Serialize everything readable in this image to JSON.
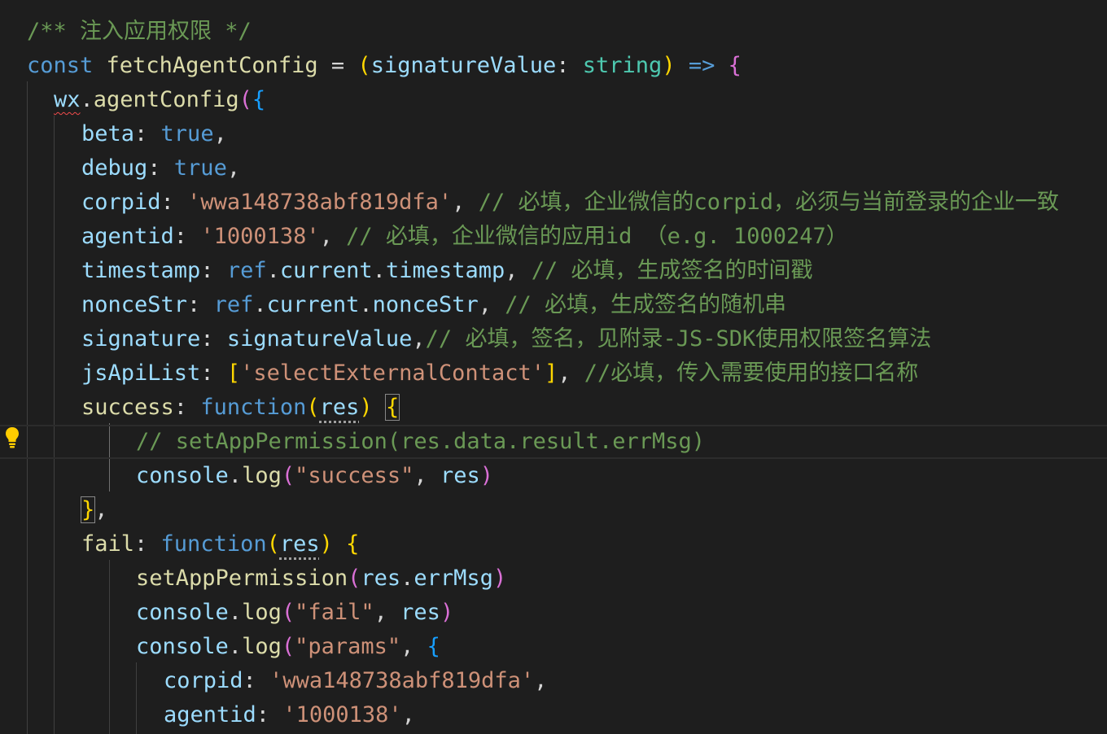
{
  "editor": {
    "lines": [
      {
        "tokens": [
          {
            "t": "/** 注入应用权限 */",
            "c": "cm"
          }
        ]
      },
      {
        "tokens": [
          {
            "t": "const ",
            "c": "kw"
          },
          {
            "t": "fetchAgentConfig",
            "c": "fn"
          },
          {
            "t": " = ",
            "c": "pu"
          },
          {
            "t": "(",
            "c": "b1"
          },
          {
            "t": "signatureValue",
            "c": "vr"
          },
          {
            "t": ": ",
            "c": "pu"
          },
          {
            "t": "string",
            "c": "ty"
          },
          {
            "t": ")",
            "c": "b1"
          },
          {
            "t": " => ",
            "c": "kw"
          },
          {
            "t": "{",
            "c": "b2"
          }
        ]
      },
      {
        "tokens": [
          {
            "t": "wx",
            "c": "vr",
            "sq": true
          },
          {
            "t": ".",
            "c": "pu"
          },
          {
            "t": "agentConfig",
            "c": "fn"
          },
          {
            "t": "(",
            "c": "b2"
          },
          {
            "t": "{",
            "c": "b3"
          }
        ]
      },
      {
        "tokens": [
          {
            "t": "beta",
            "c": "vr"
          },
          {
            "t": ": ",
            "c": "pu"
          },
          {
            "t": "true",
            "c": "kw"
          },
          {
            "t": ",",
            "c": "pu"
          }
        ]
      },
      {
        "tokens": [
          {
            "t": "debug",
            "c": "vr"
          },
          {
            "t": ": ",
            "c": "pu"
          },
          {
            "t": "true",
            "c": "kw"
          },
          {
            "t": ",",
            "c": "pu"
          }
        ]
      },
      {
        "tokens": [
          {
            "t": "corpid",
            "c": "vr"
          },
          {
            "t": ": ",
            "c": "pu"
          },
          {
            "t": "'wwa148738abf819dfa'",
            "c": "st"
          },
          {
            "t": ", ",
            "c": "pu"
          },
          {
            "t": "// 必填，企业微信的corpid，必须与当前登录的企业一致",
            "c": "cm"
          }
        ]
      },
      {
        "tokens": [
          {
            "t": "agentid",
            "c": "vr"
          },
          {
            "t": ": ",
            "c": "pu"
          },
          {
            "t": "'1000138'",
            "c": "st"
          },
          {
            "t": ", ",
            "c": "pu"
          },
          {
            "t": "// 必填，企业微信的应用id （e.g. 1000247）",
            "c": "cm"
          }
        ]
      },
      {
        "tokens": [
          {
            "t": "timestamp",
            "c": "vr"
          },
          {
            "t": ": ",
            "c": "pu"
          },
          {
            "t": "ref",
            "c": "kw"
          },
          {
            "t": ".",
            "c": "pu"
          },
          {
            "t": "current",
            "c": "vr"
          },
          {
            "t": ".",
            "c": "pu"
          },
          {
            "t": "timestamp",
            "c": "vr"
          },
          {
            "t": ", ",
            "c": "pu"
          },
          {
            "t": "// 必填，生成签名的时间戳",
            "c": "cm"
          }
        ]
      },
      {
        "tokens": [
          {
            "t": "nonceStr",
            "c": "vr"
          },
          {
            "t": ": ",
            "c": "pu"
          },
          {
            "t": "ref",
            "c": "kw"
          },
          {
            "t": ".",
            "c": "pu"
          },
          {
            "t": "current",
            "c": "vr"
          },
          {
            "t": ".",
            "c": "pu"
          },
          {
            "t": "nonceStr",
            "c": "vr"
          },
          {
            "t": ", ",
            "c": "pu"
          },
          {
            "t": "// 必填，生成签名的随机串",
            "c": "cm"
          }
        ]
      },
      {
        "tokens": [
          {
            "t": "signature",
            "c": "vr"
          },
          {
            "t": ": ",
            "c": "pu"
          },
          {
            "t": "signatureValue",
            "c": "vr"
          },
          {
            "t": ",",
            "c": "pu"
          },
          {
            "t": "// 必填，签名，见附录-JS-SDK使用权限签名算法",
            "c": "cm"
          }
        ]
      },
      {
        "tokens": [
          {
            "t": "jsApiList",
            "c": "vr"
          },
          {
            "t": ": ",
            "c": "pu"
          },
          {
            "t": "[",
            "c": "b1"
          },
          {
            "t": "'selectExternalContact'",
            "c": "st"
          },
          {
            "t": "]",
            "c": "b1"
          },
          {
            "t": ", ",
            "c": "pu"
          },
          {
            "t": "//必填，传入需要使用的接口名称",
            "c": "cm"
          }
        ]
      },
      {
        "tokens": [
          {
            "t": "success",
            "c": "fn"
          },
          {
            "t": ": ",
            "c": "pu"
          },
          {
            "t": "function",
            "c": "kw"
          },
          {
            "t": "(",
            "c": "b1"
          },
          {
            "t": "res",
            "c": "vr",
            "dots": true
          },
          {
            "t": ")",
            "c": "b1"
          },
          {
            "t": " ",
            "c": "pu"
          },
          {
            "t": "{",
            "c": "b1",
            "box": true
          }
        ]
      },
      {
        "tokens": [
          {
            "t": "// setAppPermission(res.data.result.errMsg)",
            "c": "cm"
          }
        ]
      },
      {
        "tokens": [
          {
            "t": "console",
            "c": "vr"
          },
          {
            "t": ".",
            "c": "pu"
          },
          {
            "t": "log",
            "c": "fn"
          },
          {
            "t": "(",
            "c": "b2"
          },
          {
            "t": "\"success\"",
            "c": "st"
          },
          {
            "t": ", ",
            "c": "pu"
          },
          {
            "t": "res",
            "c": "vr"
          },
          {
            "t": ")",
            "c": "b2"
          }
        ]
      },
      {
        "tokens": [
          {
            "t": "}",
            "c": "b1",
            "box": true
          },
          {
            "t": ",",
            "c": "pu"
          }
        ]
      },
      {
        "tokens": [
          {
            "t": "fail",
            "c": "fn"
          },
          {
            "t": ": ",
            "c": "pu"
          },
          {
            "t": "function",
            "c": "kw"
          },
          {
            "t": "(",
            "c": "b1"
          },
          {
            "t": "res",
            "c": "vr",
            "dots": true
          },
          {
            "t": ")",
            "c": "b1"
          },
          {
            "t": " ",
            "c": "pu"
          },
          {
            "t": "{",
            "c": "b1"
          }
        ]
      },
      {
        "tokens": [
          {
            "t": "setAppPermission",
            "c": "fn"
          },
          {
            "t": "(",
            "c": "b2"
          },
          {
            "t": "res",
            "c": "vr"
          },
          {
            "t": ".",
            "c": "pu"
          },
          {
            "t": "errMsg",
            "c": "vr"
          },
          {
            "t": ")",
            "c": "b2"
          }
        ]
      },
      {
        "tokens": [
          {
            "t": "console",
            "c": "vr"
          },
          {
            "t": ".",
            "c": "pu"
          },
          {
            "t": "log",
            "c": "fn"
          },
          {
            "t": "(",
            "c": "b2"
          },
          {
            "t": "\"fail\"",
            "c": "st"
          },
          {
            "t": ", ",
            "c": "pu"
          },
          {
            "t": "res",
            "c": "vr"
          },
          {
            "t": ")",
            "c": "b2"
          }
        ]
      },
      {
        "tokens": [
          {
            "t": "console",
            "c": "vr"
          },
          {
            "t": ".",
            "c": "pu"
          },
          {
            "t": "log",
            "c": "fn"
          },
          {
            "t": "(",
            "c": "b2"
          },
          {
            "t": "\"params\"",
            "c": "st"
          },
          {
            "t": ", ",
            "c": "pu"
          },
          {
            "t": "{",
            "c": "b3"
          }
        ]
      },
      {
        "tokens": [
          {
            "t": "corpid",
            "c": "vr"
          },
          {
            "t": ": ",
            "c": "pu"
          },
          {
            "t": "'wwa148738abf819dfa'",
            "c": "st"
          },
          {
            "t": ",",
            "c": "pu"
          }
        ]
      },
      {
        "tokens": [
          {
            "t": "agentid",
            "c": "vr"
          },
          {
            "t": ": ",
            "c": "pu"
          },
          {
            "t": "'1000138'",
            "c": "st"
          },
          {
            "t": ",",
            "c": "pu"
          }
        ]
      }
    ]
  },
  "gutter": {
    "lightbulb_icon": "lightbulb-icon"
  },
  "colors": {
    "background": "#1e1e1e",
    "comment": "#6a9955",
    "keyword": "#569cd6",
    "function": "#dcdcaa",
    "variable": "#9cdcfe",
    "string": "#ce9178",
    "type": "#4ec9b0",
    "bracket_gold": "#ffd700",
    "bracket_orchid": "#da70d6",
    "bracket_blue": "#179fff",
    "lightbulb": "#ffcc00"
  }
}
